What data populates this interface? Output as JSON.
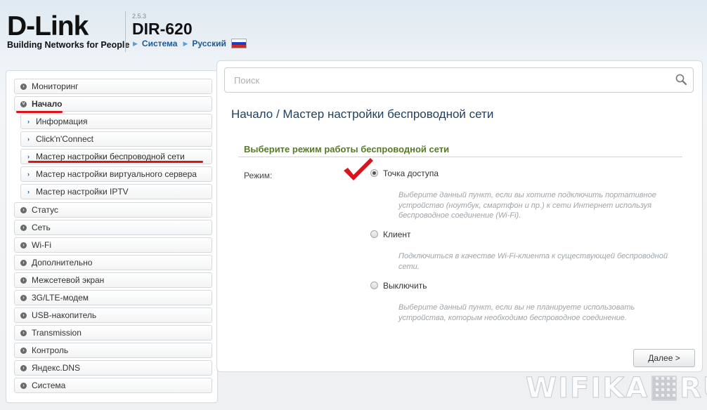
{
  "header": {
    "brand": "D-Link",
    "tagline": "Building Networks for People",
    "firmware": "2.5.3",
    "model": "DIR-620",
    "link_system": "Система",
    "link_language": "Русский"
  },
  "sidebar": {
    "items": [
      {
        "label": "Мониторинг"
      },
      {
        "label": "Начало"
      },
      {
        "label": "Информация"
      },
      {
        "label": "Click'n'Connect"
      },
      {
        "label": "Мастер настройки беспроводной сети"
      },
      {
        "label": "Мастер настройки виртуального сервера"
      },
      {
        "label": "Мастер настройки IPTV"
      },
      {
        "label": "Статус"
      },
      {
        "label": "Сеть"
      },
      {
        "label": "Wi-Fi"
      },
      {
        "label": "Дополнительно"
      },
      {
        "label": "Межсетевой экран"
      },
      {
        "label": "3G/LTE-модем"
      },
      {
        "label": "USB-накопитель"
      },
      {
        "label": "Transmission"
      },
      {
        "label": "Контроль"
      },
      {
        "label": "Яндекс.DNS"
      },
      {
        "label": "Система"
      }
    ]
  },
  "search": {
    "placeholder": "Поиск"
  },
  "main": {
    "breadcrumb": "Начало /  Мастер настройки беспроводной сети",
    "section_title": "Выберите режим работы беспроводной сети",
    "mode_label": "Режим:",
    "options": [
      {
        "label": "Точка доступа",
        "checked": true,
        "desc": "Выберите данный пункт, если вы хотите подключить портативное устройство (ноутбук, смартфон и пр.) к сети Интернет используя беспроводное соединение (Wi-Fi)."
      },
      {
        "label": "Клиент",
        "checked": false,
        "desc": "Подключиться в качестве Wi-Fi-клиента к существующей беспроводной сети."
      },
      {
        "label": "Выключить",
        "checked": false,
        "desc": "Выберите данный пункт, если вы не планируете использовать устройства, которым необходимо беспроводное соединение."
      }
    ],
    "next_button": "Далее >"
  },
  "watermark": {
    "left": "WIFIKA",
    "right": "RU"
  },
  "colors": {
    "accent_red": "#d9141b",
    "section_green": "#567a2a",
    "link_blue": "#1e5a8f"
  }
}
